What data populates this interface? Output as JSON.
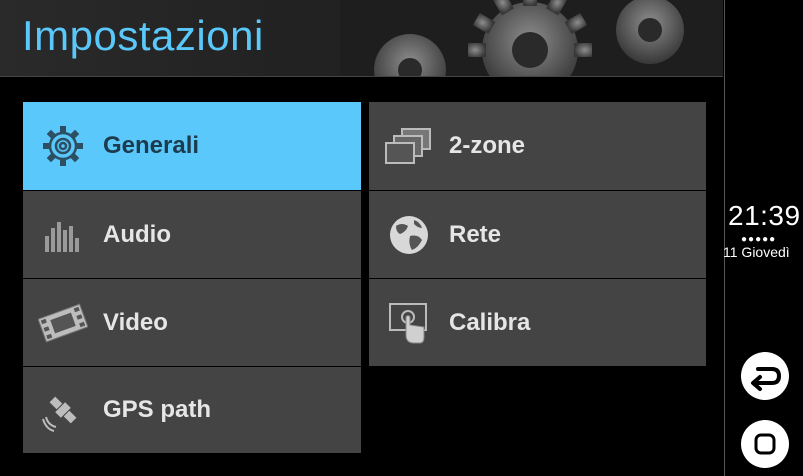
{
  "header": {
    "title": "Impostazioni"
  },
  "menu": {
    "left": [
      {
        "label": "Generali",
        "icon": "gear-icon",
        "active": true
      },
      {
        "label": "Audio",
        "icon": "equalizer-icon"
      },
      {
        "label": "Video",
        "icon": "film-icon"
      },
      {
        "label": "GPS path",
        "icon": "satellite-icon"
      }
    ],
    "right": [
      {
        "label": "2-zone",
        "icon": "dual-screen-icon"
      },
      {
        "label": "Rete",
        "icon": "globe-icon"
      },
      {
        "label": "Calibra",
        "icon": "touch-calibrate-icon"
      }
    ]
  },
  "status": {
    "time": "21:39",
    "dots": "●●●●●",
    "date": "11 Giovedì"
  },
  "nav": {
    "back": "back-icon",
    "home": "home-icon"
  },
  "colors": {
    "accent": "#5ac8fa",
    "tile": "#444444",
    "background": "#000000"
  }
}
